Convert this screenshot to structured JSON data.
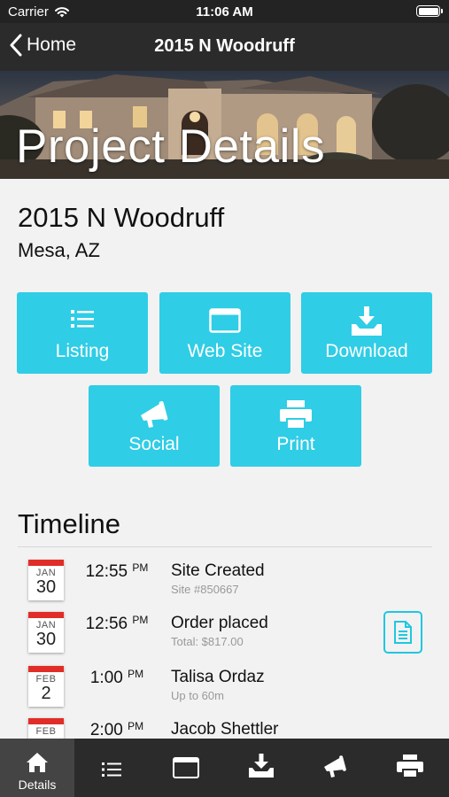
{
  "status_bar": {
    "carrier": "Carrier",
    "time": "11:06 AM"
  },
  "nav": {
    "back_label": "Home",
    "title": "2015 N Woodruff"
  },
  "hero": {
    "title": "Project Details"
  },
  "address": {
    "street": "2015 N Woodruff",
    "city": "Mesa, AZ"
  },
  "actions": {
    "listing": "Listing",
    "website": "Web Site",
    "download": "Download",
    "social": "Social",
    "print": "Print"
  },
  "timeline": {
    "title": "Timeline",
    "items": [
      {
        "month": "JAN",
        "day": "30",
        "time": "12:55",
        "ampm": "PM",
        "title": "Site Created",
        "subtitle": "Site #850667"
      },
      {
        "month": "JAN",
        "day": "30",
        "time": "12:56",
        "ampm": "PM",
        "title": "Order placed",
        "subtitle": "Total: $817.00"
      },
      {
        "month": "FEB",
        "day": "2",
        "time": "1:00",
        "ampm": "PM",
        "title": "Talisa Ordaz",
        "subtitle": "Up to 60m"
      },
      {
        "month": "FEB",
        "day": "",
        "time": "2:00",
        "ampm": "PM",
        "title": "Jacob Shettler",
        "subtitle": ""
      }
    ]
  },
  "tab_bar": {
    "details_label": "Details"
  },
  "colors": {
    "accent": "#2fcde6",
    "bar": "#2b2b2b",
    "calendar_red": "#e12d27"
  }
}
